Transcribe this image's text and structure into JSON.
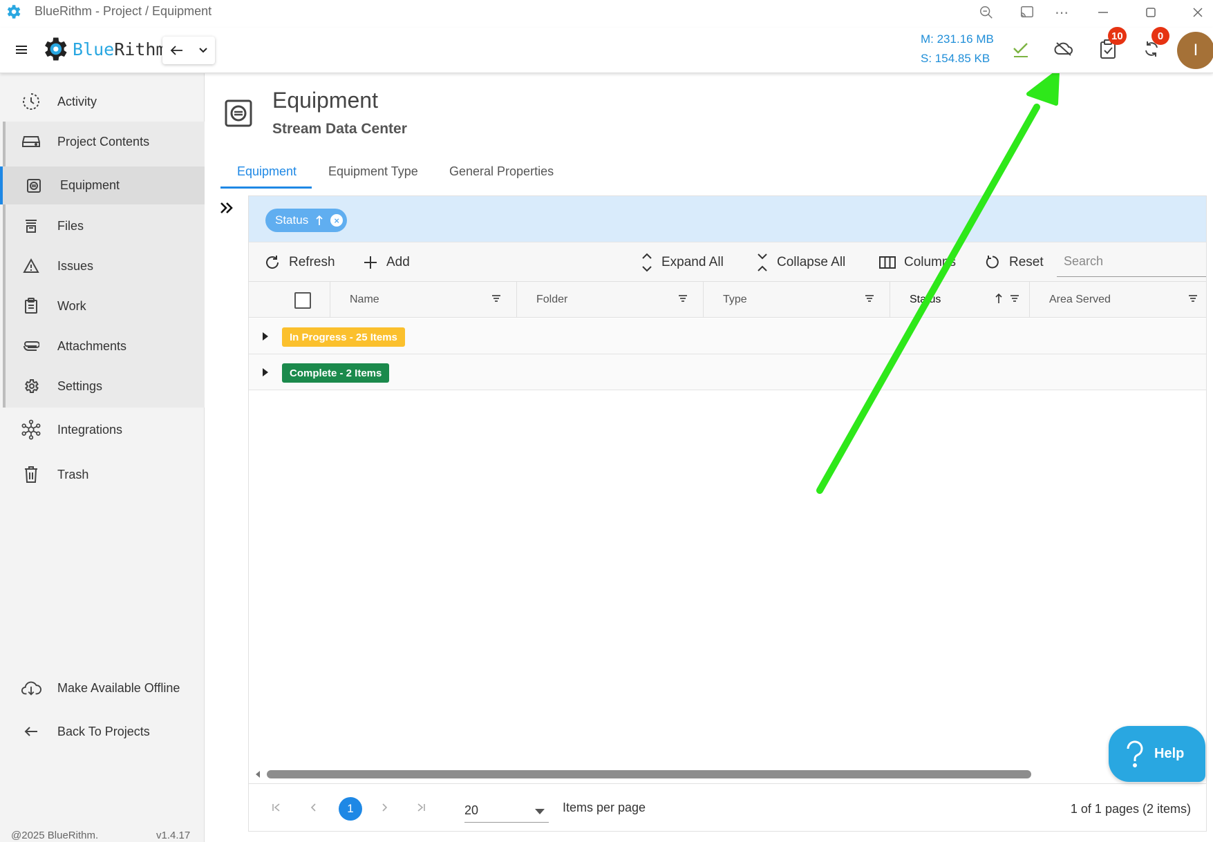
{
  "window": {
    "title": "BlueRithm - Project / Equipment"
  },
  "header": {
    "brand_left": "Blue",
    "brand_right": "Rithm",
    "memory": "M: 231.16 MB",
    "storage": "S: 154.85 KB",
    "tasks_badge": "10",
    "sync_badge": "0",
    "avatar_initial": "I"
  },
  "sidebar": {
    "items": [
      {
        "label": "Activity"
      },
      {
        "label": "Project Contents"
      },
      {
        "label": "Equipment"
      },
      {
        "label": "Files"
      },
      {
        "label": "Issues"
      },
      {
        "label": "Work"
      },
      {
        "label": "Attachments"
      },
      {
        "label": "Settings"
      },
      {
        "label": "Integrations"
      },
      {
        "label": "Trash"
      }
    ],
    "offline_label": "Make Available Offline",
    "back_label": "Back To Projects",
    "copyright": "@2025 BlueRithm.",
    "version": "v1.4.17"
  },
  "page": {
    "title": "Equipment",
    "subtitle": "Stream Data Center",
    "tabs": [
      {
        "label": "Equipment",
        "active": true
      },
      {
        "label": "Equipment Type",
        "active": false
      },
      {
        "label": "General Properties",
        "active": false
      }
    ]
  },
  "grid": {
    "group_chip": "Status",
    "toolbar": {
      "refresh": "Refresh",
      "add": "Add",
      "expand_all": "Expand All",
      "collapse_all": "Collapse All",
      "columns": "Columns",
      "reset": "Reset",
      "search_placeholder": "Search"
    },
    "columns": [
      "Name",
      "Folder",
      "Type",
      "Status",
      "Area Served"
    ],
    "groups": [
      {
        "label": "In Progress - 25 Items",
        "bg": "#fbc02d",
        "fg": "#ffffff"
      },
      {
        "label": "Complete - 2 Items",
        "bg": "#1b8a4c",
        "fg": "#ffffff"
      }
    ],
    "pager": {
      "current_page": "1",
      "page_size": "20",
      "items_per_page_label": "Items per page",
      "summary": "1 of 1 pages (2 items)"
    }
  },
  "help_label": "Help",
  "colors": {
    "accent": "#1e88e5",
    "brand": "#29a7e1",
    "annotation_arrow": "#2ee81a"
  }
}
